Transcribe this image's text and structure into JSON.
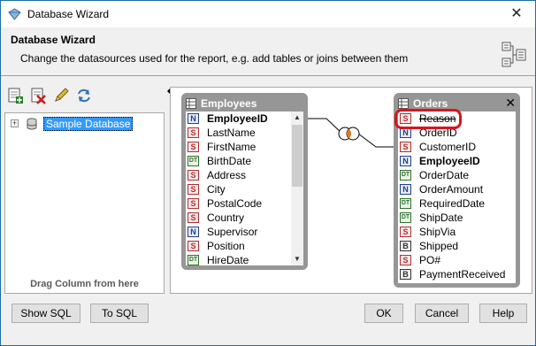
{
  "window": {
    "title": "Database Wizard"
  },
  "header": {
    "title": "Database Wizard",
    "description": "Change the datasources used for the report, e.g. add tables or joins between them"
  },
  "left_panel": {
    "tree_root": "Sample Database",
    "drag_hint": "Drag Column from here"
  },
  "tables": {
    "employees": {
      "name": "Employees",
      "fields": [
        {
          "type": "N",
          "name": "EmployeeID",
          "bold": true
        },
        {
          "type": "S",
          "name": "LastName"
        },
        {
          "type": "S",
          "name": "FirstName"
        },
        {
          "type": "DT",
          "name": "BirthDate"
        },
        {
          "type": "S",
          "name": "Address"
        },
        {
          "type": "S",
          "name": "City"
        },
        {
          "type": "S",
          "name": "PostalCode"
        },
        {
          "type": "S",
          "name": "Country"
        },
        {
          "type": "N",
          "name": "Supervisor"
        },
        {
          "type": "S",
          "name": "Position"
        },
        {
          "type": "DT",
          "name": "HireDate"
        }
      ]
    },
    "orders": {
      "name": "Orders",
      "fields": [
        {
          "type": "S",
          "name": "Reason",
          "strike": true
        },
        {
          "type": "N",
          "name": "OrderID"
        },
        {
          "type": "S",
          "name": "CustomerID"
        },
        {
          "type": "N",
          "name": "EmployeeID",
          "bold": true
        },
        {
          "type": "DT",
          "name": "OrderDate"
        },
        {
          "type": "N",
          "name": "OrderAmount"
        },
        {
          "type": "DT",
          "name": "RequiredDate"
        },
        {
          "type": "DT",
          "name": "ShipDate"
        },
        {
          "type": "S",
          "name": "ShipVia"
        },
        {
          "type": "B",
          "name": "Shipped"
        },
        {
          "type": "S",
          "name": "PO#"
        },
        {
          "type": "B",
          "name": "PaymentReceived"
        }
      ]
    }
  },
  "buttons": {
    "show_sql": "Show SQL",
    "to_sql": "To SQL",
    "ok": "OK",
    "cancel": "Cancel",
    "help": "Help"
  },
  "colors": {
    "highlight": "#d8141e",
    "selection": "#3399ff",
    "table_border": "#969696"
  }
}
